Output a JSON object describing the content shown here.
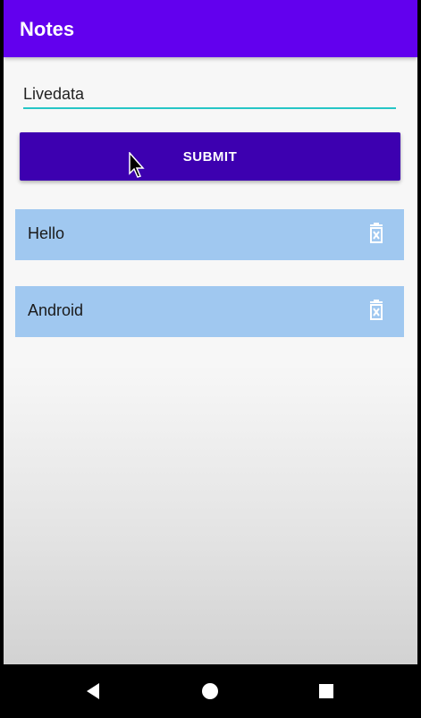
{
  "app_bar": {
    "title": "Notes"
  },
  "input": {
    "value": "Livedata"
  },
  "submit": {
    "label": "SUBMIT"
  },
  "notes": [
    {
      "text": "Hello",
      "icon": "delete-icon"
    },
    {
      "text": "Android",
      "icon": "delete-icon"
    }
  ],
  "nav": {
    "back_icon": "back-triangle-icon",
    "home_icon": "home-circle-icon",
    "recents_icon": "recents-square-icon"
  },
  "colors": {
    "app_bar": "#6200ee",
    "button": "#3d00b0",
    "note_bg": "#a0c8f0",
    "underline": "#26c6c6"
  }
}
